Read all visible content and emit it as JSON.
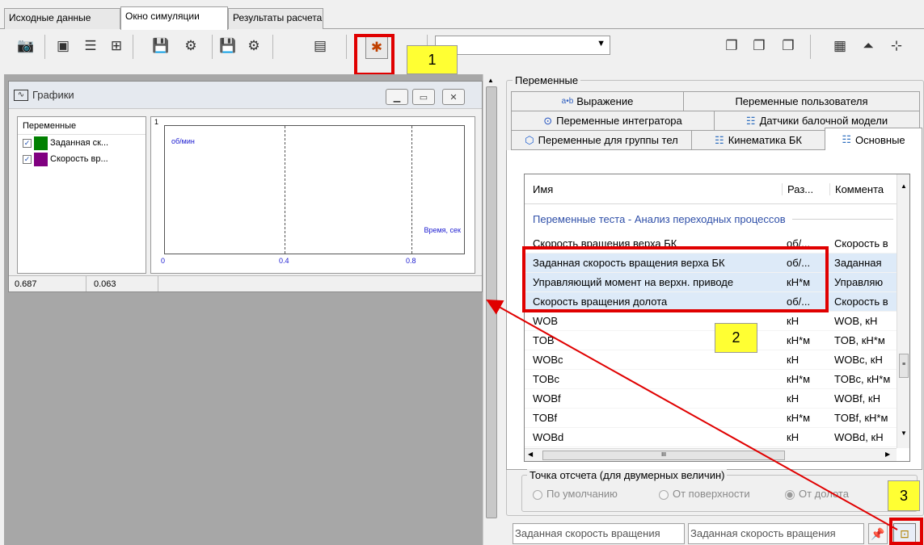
{
  "main_tabs": [
    "Исходные данные",
    "Окно симуляции",
    "Результаты расчета"
  ],
  "toolbar": {
    "combo_value": ""
  },
  "callouts": [
    "1",
    "2",
    "3"
  ],
  "graph_window": {
    "title": "Графики",
    "var_header": "Переменные",
    "variables": [
      {
        "label": "Заданная ск...",
        "color": "#008000",
        "checked": true
      },
      {
        "label": "Скорость вр...",
        "color": "#800080",
        "checked": true
      }
    ],
    "plot": {
      "y_top": "1",
      "y_unit": "об/мин",
      "x_label": "Время, сек",
      "x_ticks": [
        "0",
        "0.4",
        "0.8"
      ]
    },
    "status": [
      "0.687",
      "0.063"
    ]
  },
  "right_panel": {
    "group_title": "Переменные",
    "tabs_row1": [
      "Выражение",
      "Переменные пользователя"
    ],
    "tabs_row2": [
      "Переменные интегратора",
      "Датчики балочной модели"
    ],
    "tabs_row3": [
      "Переменные для группы тел",
      "Кинематика БК",
      "Основные"
    ],
    "grid": {
      "headers": [
        "Имя",
        "Раз...",
        "Коммента"
      ],
      "section": "Переменные теста - Анализ переходных процессов",
      "rows": [
        {
          "name": "Скорость вращения верха БК",
          "unit": "об/...",
          "comment": "Скорость в"
        },
        {
          "name": "Заданная скорость вращения верха БК",
          "unit": "об/...",
          "comment": "Заданная"
        },
        {
          "name": "Управляющий момент на верхн. приводе",
          "unit": "кН*м",
          "comment": "Управляю"
        },
        {
          "name": "Скорость вращения долота",
          "unit": "об/...",
          "comment": "Скорость в"
        },
        {
          "name": "WOB",
          "unit": "кН",
          "comment": "WOB, кН"
        },
        {
          "name": "TOB",
          "unit": "кН*м",
          "comment": "TOB, кН*м"
        },
        {
          "name": "WOBc",
          "unit": "кН",
          "comment": "WOBc, кН"
        },
        {
          "name": "TOBc",
          "unit": "кН*м",
          "comment": "TOBc, кН*м"
        },
        {
          "name": "WOBf",
          "unit": "кН",
          "comment": "WOBf, кН"
        },
        {
          "name": "TOBf",
          "unit": "кН*м",
          "comment": "TOBf, кН*м"
        },
        {
          "name": "WOBd",
          "unit": "кН",
          "comment": "WOBd, кН"
        }
      ],
      "hscroll_grip": "III"
    },
    "ref_point": {
      "title": "Точка отсчета (для двумерных величин)",
      "options": [
        "По умолчанию",
        "От поверхности",
        "От долота"
      ]
    },
    "bottom_fields": [
      "Заданная скорость вращения",
      "Заданная скорость вращения"
    ]
  }
}
